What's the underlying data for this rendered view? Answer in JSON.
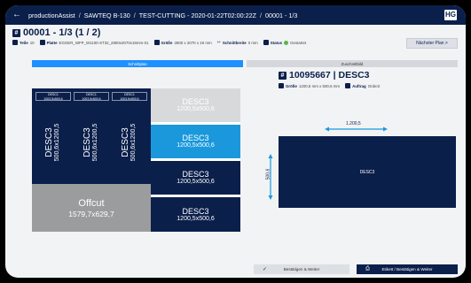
{
  "topbar": {
    "back_icon": "arrow-left-icon",
    "crumbs": [
      "productionAssist",
      "SAWTEQ B-130",
      "TEST-CUTTING - 2020-01-22T02:00:22Z",
      "00001 - 1/3"
    ],
    "separator": "/",
    "logo": "HG"
  },
  "header": {
    "title": "00001 - 1/3 (1 / 2)",
    "meta": [
      {
        "label": "Teile",
        "value": "10"
      },
      {
        "label": "Platte",
        "value": "EGGER_WFP_W1100-ST32_2800x2070x19mm-01"
      },
      {
        "label": "Größe",
        "value": "2800 x 2070 x 19 mm"
      },
      {
        "label": "Schnittbreite",
        "value": "0 mm"
      },
      {
        "label": "Status",
        "value": "Gestartet"
      }
    ],
    "next_button": "Nächster Plan  >"
  },
  "tabs": [
    {
      "label": "Schnittplan",
      "active": true
    },
    {
      "label": "Zuschnittbild",
      "active": false
    }
  ],
  "layout": {
    "strip_top_labels": [
      {
        "l1": "DESC1",
        "l2": "1003,5x500,6"
      },
      {
        "l1": "DESC1",
        "l2": "1003,5x500,6"
      },
      {
        "l1": "DESC1",
        "l2": "1003,5x500,6"
      }
    ],
    "strips": [
      {
        "l1": "DESC3",
        "l2": "500,6x1200,5"
      },
      {
        "l1": "DESC3",
        "l2": "500,6x1200,5"
      },
      {
        "l1": "DESC3",
        "l2": "500,6x1200,5"
      }
    ],
    "offcut": {
      "l1": "Offcut",
      "l2": "1579,7x629,7"
    },
    "panels": [
      {
        "l1": "DESC3",
        "l2": "1200,5x500,6",
        "state": "done"
      },
      {
        "l1": "DESC3",
        "l2": "1200,5x500,6",
        "state": "selected"
      },
      {
        "l1": "DESC3",
        "l2": "1200,5x500,6",
        "state": "open"
      },
      {
        "l1": "DESC3",
        "l2": "1200,5x500,6",
        "state": "open"
      }
    ]
  },
  "part": {
    "title": "10095667 | DESC3",
    "size_label": "Größe",
    "size_value": "1200,5 mm x 500,6 mm",
    "order_label": "Auftrag",
    "order_value": "Order2",
    "preview_label": "DESC3",
    "width_dim": "1.200,5",
    "height_dim": "500,6"
  },
  "footer": {
    "confirm_continue": "Bestätigen & Weiter",
    "label_confirm_continue": "Etikett / Bestätigen & Weiter"
  },
  "colors": {
    "navy": "#0b1f4b",
    "accent": "#1a98db",
    "status_green": "#58b947",
    "offcut": "#9b9c9e"
  }
}
